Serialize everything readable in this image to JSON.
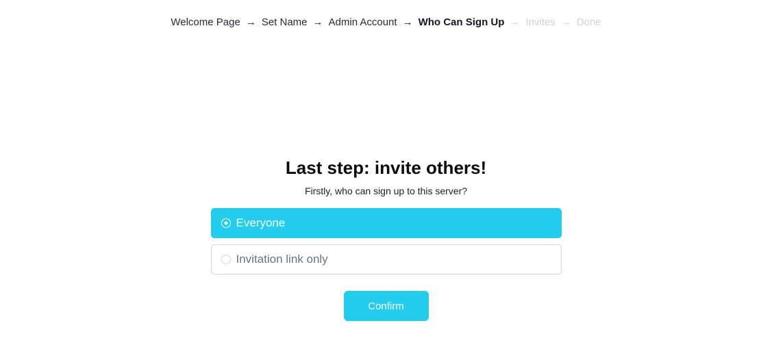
{
  "breadcrumb": {
    "steps": [
      {
        "label": "Welcome Page",
        "state": "done"
      },
      {
        "label": "Set Name",
        "state": "done"
      },
      {
        "label": "Admin Account",
        "state": "done"
      },
      {
        "label": "Who Can Sign Up",
        "state": "current"
      },
      {
        "label": "Invites",
        "state": "future"
      },
      {
        "label": "Done",
        "state": "future"
      }
    ],
    "separator": "→"
  },
  "main": {
    "title": "Last step: invite others!",
    "subtitle": "Firstly, who can sign up to this server?",
    "options": [
      {
        "label": "Everyone",
        "selected": true
      },
      {
        "label": "Invitation link only",
        "selected": false
      }
    ],
    "confirm_label": "Confirm"
  },
  "colors": {
    "accent": "#22cdee",
    "future_step": "#cbd5e1"
  }
}
